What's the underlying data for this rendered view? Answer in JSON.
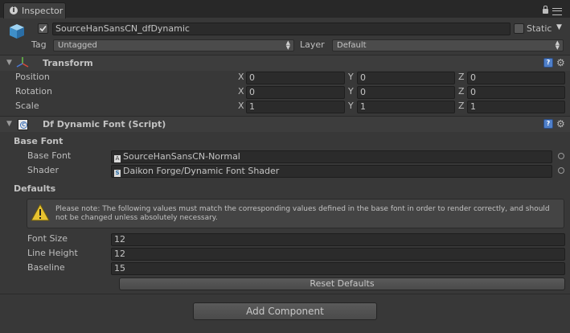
{
  "tab": {
    "title": "Inspector"
  },
  "object": {
    "name": "SourceHanSansCN_dfDynamic",
    "static_label": "Static",
    "tag_label": "Tag",
    "tag_value": "Untagged",
    "layer_label": "Layer",
    "layer_value": "Default"
  },
  "transform": {
    "title": "Transform",
    "rows": [
      {
        "label": "Position",
        "x": "0",
        "y": "0",
        "z": "0"
      },
      {
        "label": "Rotation",
        "x": "0",
        "y": "0",
        "z": "0"
      },
      {
        "label": "Scale",
        "x": "1",
        "y": "1",
        "z": "1"
      }
    ],
    "axis": {
      "x": "X",
      "y": "Y",
      "z": "Z"
    }
  },
  "script": {
    "title": "Df Dynamic Font (Script)",
    "base_font_section": "Base Font",
    "base_font_label": "Base Font",
    "base_font_value": "SourceHanSansCN-Normal",
    "shader_label": "Shader",
    "shader_value": "Daikon Forge/Dynamic Font Shader",
    "defaults_section": "Defaults",
    "warning": "Please note: The following values must match the corresponding values defined in the base font in order to render correctly, and should not be changed unless absolutely necessary.",
    "font_size_label": "Font Size",
    "font_size": "12",
    "line_height_label": "Line Height",
    "line_height": "12",
    "baseline_label": "Baseline",
    "baseline": "15",
    "reset_button": "Reset Defaults"
  },
  "add_component": "Add Component"
}
